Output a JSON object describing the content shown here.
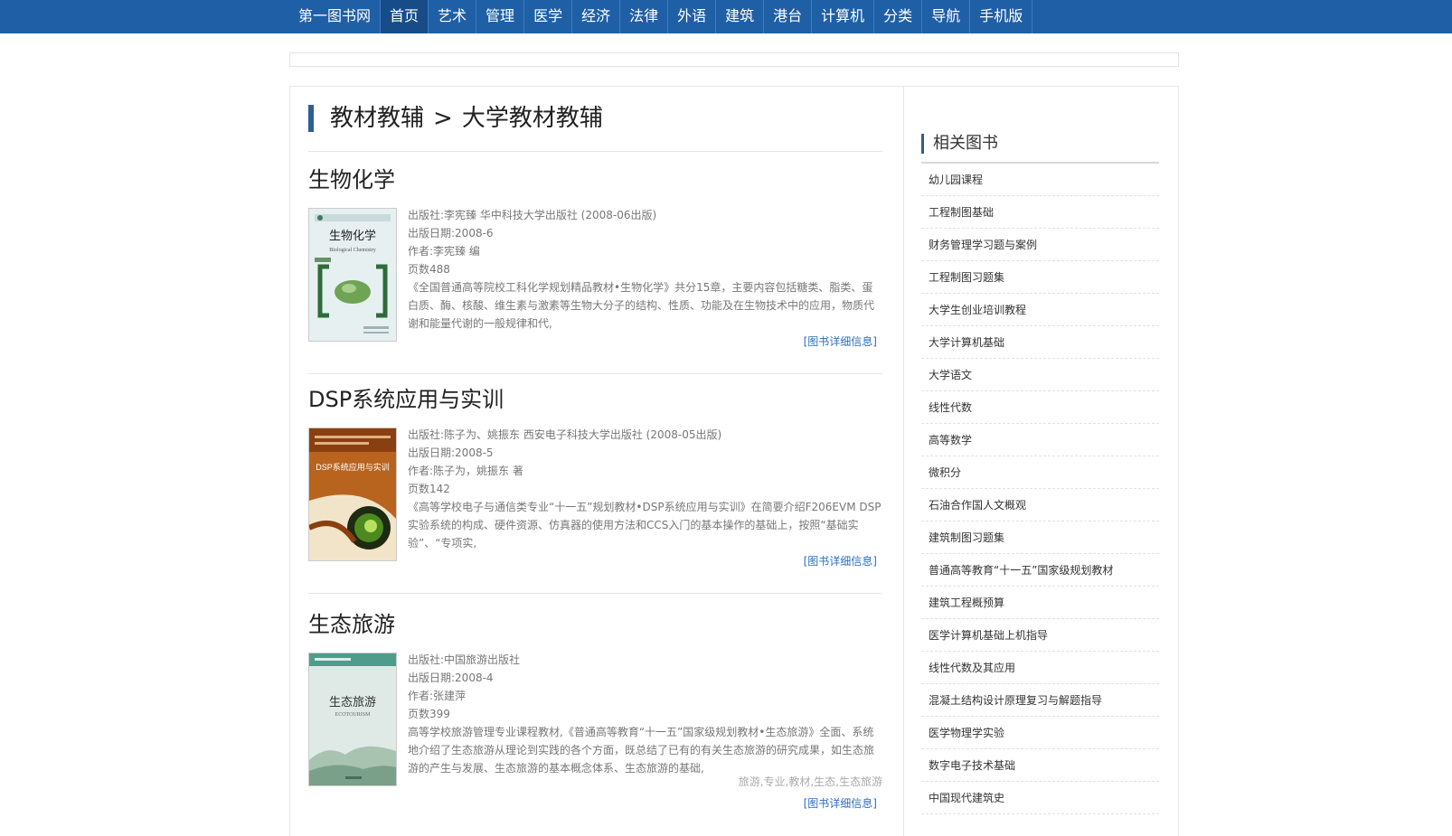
{
  "nav": {
    "brand": "第一图书网",
    "items": [
      "首页",
      "艺术",
      "管理",
      "医学",
      "经济",
      "法律",
      "外语",
      "建筑",
      "港台",
      "计算机",
      "分类",
      "导航",
      "手机版"
    ],
    "active_index": 0
  },
  "colors": {
    "nav_bg": "#1f5fa6",
    "accent": "#2c5f96",
    "link": "#2c6ec0"
  },
  "breadcrumb": {
    "parent": "教材教辅",
    "separator": ">",
    "current": "大学教材教辅"
  },
  "books": [
    {
      "title": "生物化学",
      "publisher": "出版社:李宪臻 华中科技大学出版社 (2008-06出版)",
      "date": "出版日期:2008-6",
      "author": "作者:李宪臻 编",
      "pages": "页数488",
      "desc": "《全国普通高等院校工科化学规划精品教材•生物化学》共分15章，主要内容包括糖类、脂类、蛋白质、酶、核酸、维生素与激素等生物大分子的结构、性质、功能及在生物技术中的应用，物质代谢和能量代谢的一般规律和代,",
      "tags": "",
      "more": "[图书详细信息]",
      "cover": {
        "title": "生物化学",
        "subtitle": "Biological Chemistry",
        "icon": "leaf-bracket-icon"
      }
    },
    {
      "title": "DSP系统应用与实训",
      "publisher": "出版社:陈子为、姚振东 西安电子科技大学出版社 (2008-05出版)",
      "date": "出版日期:2008-5",
      "author": "作者:陈子为，姚振东 著",
      "pages": "页数142",
      "desc": "《高等学校电子与通信类专业“十一五”规划教材•DSP系统应用与实训》在简要介绍F206EVM DSP实验系统的构成、硬件资源、仿真器的使用方法和CCS入门的基本操作的基础上，按照“基础实验”、“专项实,",
      "tags": "",
      "more": "[图书详细信息]",
      "cover": {
        "title": "DSP系统应用与实训",
        "icon": "green-orb-icon"
      }
    },
    {
      "title": "生态旅游",
      "publisher": "出版社:中国旅游出版社",
      "date": "出版日期:2008-4",
      "author": "作者:张建萍",
      "pages": "页数399",
      "desc": "高等学校旅游管理专业课程教材,《普通高等教育“十一五”国家级规划教材•生态旅游》全面、系统地介绍了生态旅游从理论到实践的各个方面，既总结了已有的有关生态旅游的研究成果，如生态旅游的产生与发展、生态旅游的基本概念体系、生态旅游的基础,",
      "tags": "旅游,专业,教材,生态,生态旅游",
      "more": "[图书详细信息]",
      "cover": {
        "title": "生态旅游",
        "subtitle": "ECOTOURISM",
        "icon": "landscape-icon"
      }
    }
  ],
  "sidebar": {
    "title": "相关图书",
    "items": [
      "幼儿园课程",
      "工程制图基础",
      "财务管理学习题与案例",
      "工程制图习题集",
      "大学生创业培训教程",
      "大学计算机基础",
      "大学语文",
      "线性代数",
      "高等数学",
      "微积分",
      "石油合作国人文概观",
      "建筑制图习题集",
      "普通高等教育“十一五”国家级规划教材",
      "建筑工程概预算",
      "医学计算机基础上机指导",
      "线性代数及其应用",
      "混凝土结构设计原理复习与解题指导",
      "医学物理学实验",
      "数字电子技术基础",
      "中国现代建筑史"
    ]
  }
}
